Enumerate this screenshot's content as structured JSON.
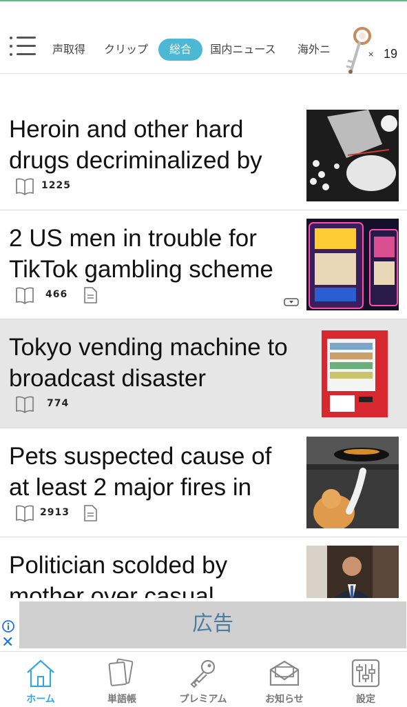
{
  "colors": {
    "accent": "#4cb8d3",
    "active_tab_label": "#34a6dd",
    "highlight_row": "#e6e6e6"
  },
  "header": {
    "tabs": [
      {
        "label": "声取得",
        "active": false
      },
      {
        "label": "クリップ",
        "active": false
      },
      {
        "label": "総合",
        "active": true
      },
      {
        "label": "国内ニュース",
        "active": false
      },
      {
        "label": "海外ニ",
        "active": false
      }
    ],
    "key_multiplier": "×",
    "key_count": "19"
  },
  "articles": [
    {
      "title": "Heroin and other hard drugs decriminalized by",
      "count": "1225",
      "has_doc": false,
      "has_audio": false,
      "image": "drugs-photo",
      "highlighted": false
    },
    {
      "title": "2 US men in trouble for TikTok gambling scheme",
      "count": "466",
      "has_doc": true,
      "has_audio": true,
      "image": "slot-machines-photo",
      "highlighted": false
    },
    {
      "title": "Tokyo vending machine to broadcast disaster",
      "count": "774",
      "has_doc": false,
      "has_audio": false,
      "image": "vending-machine-photo",
      "highlighted": true
    },
    {
      "title": "Pets suspected cause of at least 2 major fires in",
      "count": "2913",
      "has_doc": true,
      "has_audio": false,
      "image": "cat-stove-photo",
      "highlighted": false
    },
    {
      "title": "Politician scolded by mother over casual",
      "count": "",
      "has_doc": false,
      "has_audio": false,
      "image": "politician-photo",
      "highlighted": false
    }
  ],
  "ad": {
    "text": "広告",
    "close_symbol": "✕"
  },
  "tabbar": [
    {
      "label": "ホーム",
      "icon": "home-icon",
      "active": true
    },
    {
      "label": "単語帳",
      "icon": "cards-icon",
      "active": false
    },
    {
      "label": "プレミアム",
      "icon": "key-icon",
      "active": false
    },
    {
      "label": "お知らせ",
      "icon": "mail-icon",
      "active": false
    },
    {
      "label": "設定",
      "icon": "sliders-icon",
      "active": false
    }
  ]
}
